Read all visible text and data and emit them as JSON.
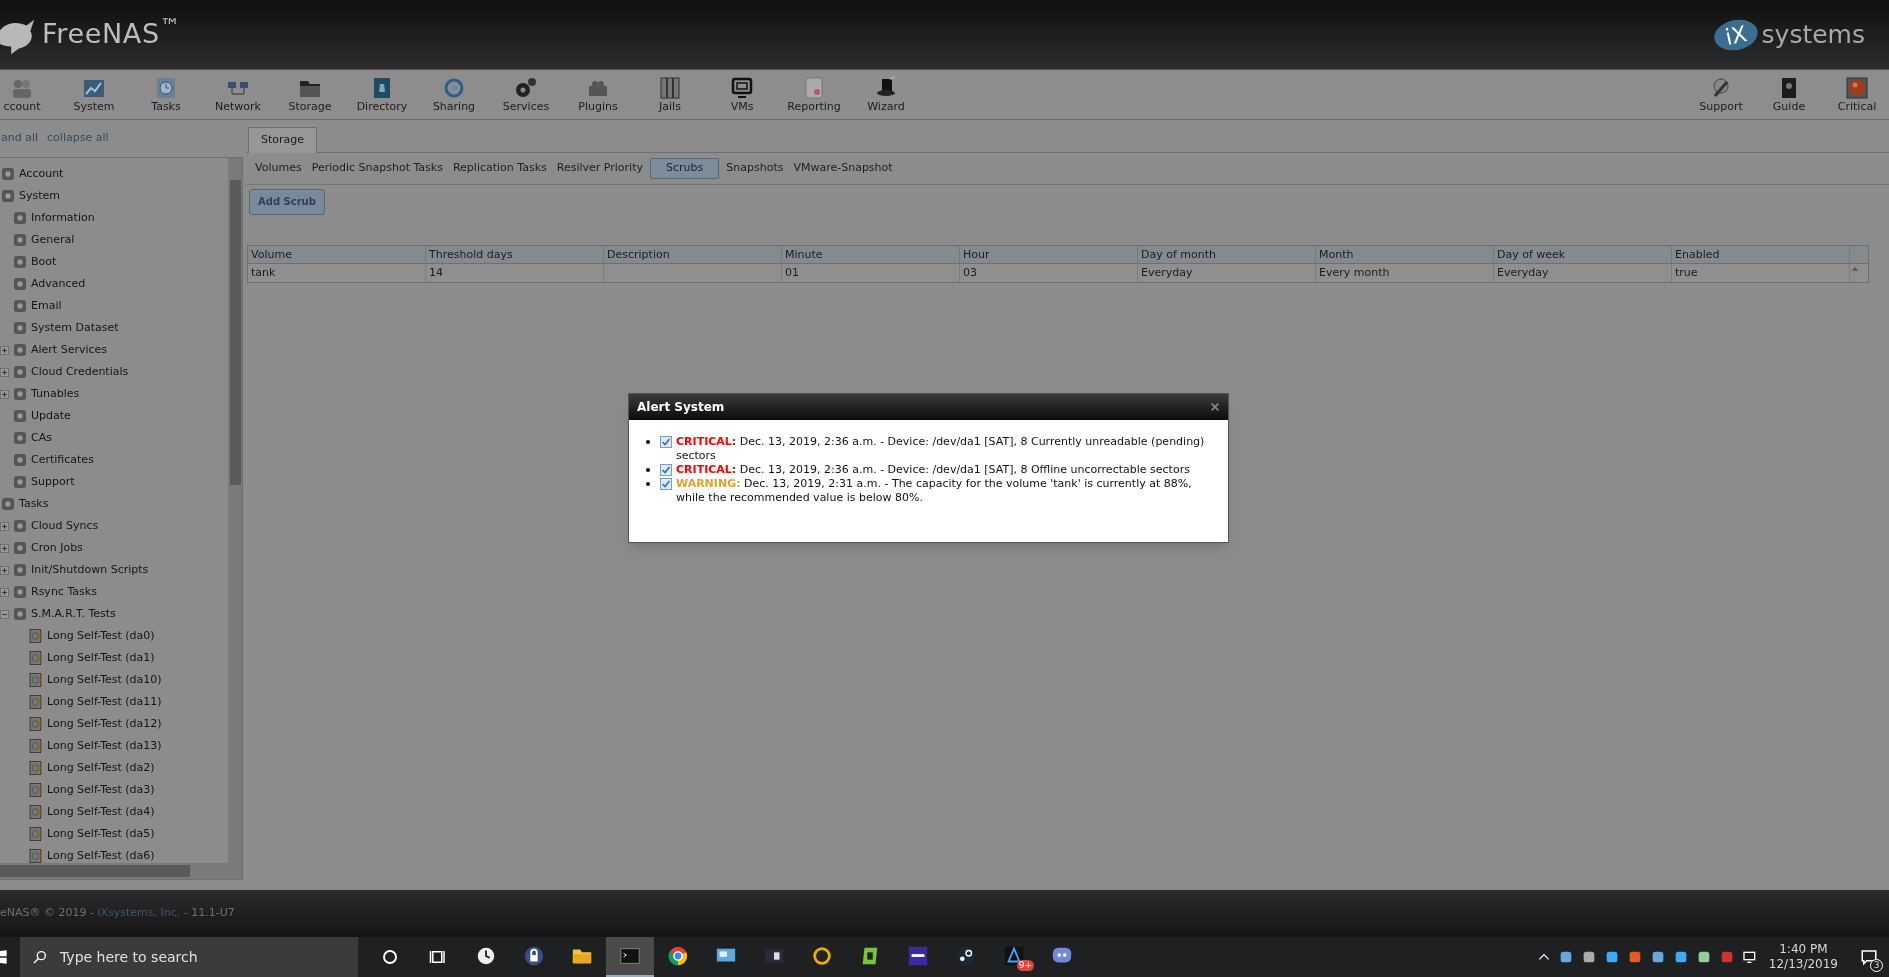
{
  "header": {
    "logo": "FreeNAS$^{™}$",
    "brand_mark": "iX",
    "brand_name": "systems"
  },
  "toolbar": {
    "left": [
      "ccount",
      "System",
      "Tasks",
      "Network",
      "Storage",
      "Directory",
      "Sharing",
      "Services",
      "Plugins",
      "Jails",
      "VMs",
      "Reporting",
      "Wizard"
    ],
    "right": [
      "Support",
      "Guide",
      "Critical"
    ]
  },
  "sidebar": {
    "expand_all": "and all",
    "collapse_all": "collapse all",
    "tree": [
      {
        "label": "Account"
      },
      {
        "label": "System",
        "children": [
          {
            "label": "Information"
          },
          {
            "label": "General"
          },
          {
            "label": "Boot"
          },
          {
            "label": "Advanced"
          },
          {
            "label": "Email"
          },
          {
            "label": "System Dataset"
          },
          {
            "label": "Alert Services",
            "expanded": false
          },
          {
            "label": "Cloud Credentials",
            "expanded": false
          },
          {
            "label": "Tunables",
            "expanded": false
          },
          {
            "label": "Update"
          },
          {
            "label": "CAs"
          },
          {
            "label": "Certificates"
          },
          {
            "label": "Support"
          }
        ]
      },
      {
        "label": "Tasks",
        "children": [
          {
            "label": "Cloud Syncs",
            "expanded": false
          },
          {
            "label": "Cron Jobs",
            "expanded": false
          },
          {
            "label": "Init/Shutdown Scripts",
            "expanded": false
          },
          {
            "label": "Rsync Tasks",
            "expanded": false
          },
          {
            "label": "S.M.A.R.T. Tests",
            "expanded": true,
            "children": [
              {
                "label": "Long Self-Test (da0)"
              },
              {
                "label": "Long Self-Test (da1)"
              },
              {
                "label": "Long Self-Test (da10)"
              },
              {
                "label": "Long Self-Test (da11)"
              },
              {
                "label": "Long Self-Test (da12)"
              },
              {
                "label": "Long Self-Test (da13)"
              },
              {
                "label": "Long Self-Test (da2)"
              },
              {
                "label": "Long Self-Test (da3)"
              },
              {
                "label": "Long Self-Test (da4)"
              },
              {
                "label": "Long Self-Test (da5)"
              },
              {
                "label": "Long Self-Test (da6)"
              }
            ]
          }
        ]
      }
    ]
  },
  "tabs": [
    {
      "label": "Storage",
      "selected": true
    }
  ],
  "subtabs": [
    {
      "label": "Volumes",
      "selected": false
    },
    {
      "label": "Periodic Snapshot Tasks",
      "selected": false
    },
    {
      "label": "Replication Tasks",
      "selected": false
    },
    {
      "label": "Resilver Priority",
      "selected": false
    },
    {
      "label": "Scrubs",
      "selected": true
    },
    {
      "label": "Snapshots",
      "selected": false
    },
    {
      "label": "VMware-Snapshot",
      "selected": false
    }
  ],
  "add_button": "Add Scrub",
  "table": {
    "columns": [
      "Volume",
      "Threshold days",
      "Description",
      "Minute",
      "Hour",
      "Day of month",
      "Month",
      "Day of week",
      "Enabled"
    ],
    "rows": [
      [
        "tank",
        "14",
        null,
        "01",
        "03",
        "Everyday",
        "Every month",
        "Everyday",
        "true"
      ]
    ]
  },
  "dialog": {
    "title": "Alert System",
    "alerts": [
      {
        "kind": "critical",
        "checked": true,
        "label": "CRITICAL:",
        "text": "Dec. 13, 2019, 2:36 a.m. - Device: /dev/da1 [SAT], 8 Currently unreadable (pending) sectors"
      },
      {
        "kind": "critical",
        "checked": true,
        "label": "CRITICAL:",
        "text": "Dec. 13, 2019, 2:36 a.m. - Device: /dev/da1 [SAT], 8 Offline uncorrectable sectors"
      },
      {
        "kind": "warning",
        "checked": true,
        "label": "WARNING:",
        "text": "Dec. 13, 2019, 2:31 a.m. - The capacity for the volume 'tank' is currently at 88%, while the recommended value is below 80%."
      }
    ]
  },
  "footer": {
    "prefix": "eNAS® © 2019 - ",
    "link": "iXsystems, Inc.",
    "suffix": " - 11.1-U7"
  },
  "taskbar": {
    "search_placeholder": "Type here to search",
    "apps": [
      {
        "selected": false
      },
      {
        "selected": false
      },
      {
        "selected": false
      },
      {
        "selected": true
      },
      {
        "selected": false
      },
      {
        "selected": false
      },
      {
        "selected": false
      },
      {
        "selected": false
      },
      {
        "selected": false
      },
      {
        "selected": false
      },
      {
        "selected": false
      },
      {
        "selected": false,
        "badge": "9+"
      },
      {
        "selected": false
      }
    ],
    "time": "1:40 PM",
    "date": "12/13/2019",
    "notifications": "3"
  }
}
